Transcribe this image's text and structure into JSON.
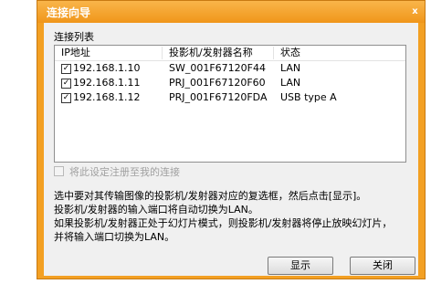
{
  "window": {
    "title": "连接向导",
    "close_glyph": "x"
  },
  "list_label": "连接列表",
  "columns": [
    "IP地址",
    "投影机/发射器名称",
    "状态"
  ],
  "rows": [
    {
      "checked": true,
      "ip": "192.168.1.10",
      "name": "SW_001F67120F44",
      "status": "LAN"
    },
    {
      "checked": true,
      "ip": "192.168.1.11",
      "name": "PRJ_001F67120F60",
      "status": "LAN"
    },
    {
      "checked": true,
      "ip": "192.168.1.12",
      "name": "PRJ_001F67120FDA",
      "status": "USB type A"
    }
  ],
  "register_checkbox_label": "将此设定注册至我的连接",
  "instructions": [
    "选中要对其传输图像的投影机/发射器对应的复选框，然后点击[显示]。",
    "投影机/发射器的输入端口将自动切换为LAN。",
    "如果投影机/发射器正处于幻灯片模式，则投影机/发射器将停止放映幻灯片，",
    "并将输入端口切换为LAN。"
  ],
  "buttons": {
    "display": "显示",
    "close": "关闭"
  },
  "colors": {
    "window_frame": "#f3a023",
    "client_bg": "#f0f0f0"
  }
}
